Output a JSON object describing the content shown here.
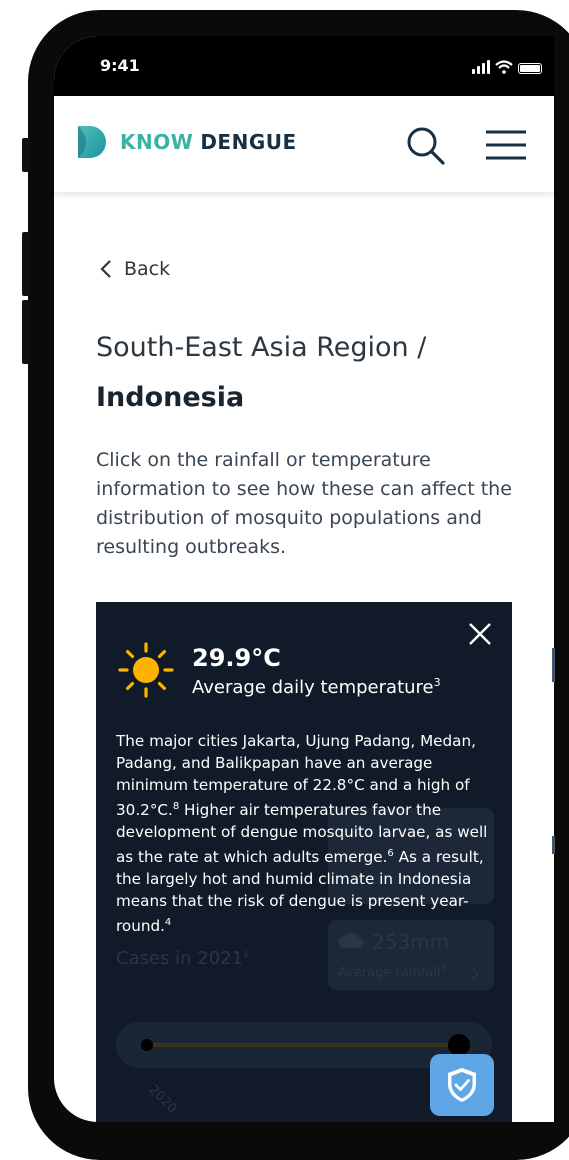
{
  "status": {
    "time": "9:41"
  },
  "header": {
    "logo_know": "KNOW",
    "logo_dengue": "DENGUE"
  },
  "nav": {
    "back_label": "Back"
  },
  "page": {
    "region": "South-East Asia Region /",
    "country": "Indonesia",
    "intro": "Click on the rainfall or temperature information to see how these can affect the distribution of mosquito populations and resulting outbreaks."
  },
  "temperature": {
    "value": "29.9°C",
    "label": "Average daily temperature",
    "label_ref": "3",
    "description": [
      {
        "text": "The major cities Jakarta, Ujung Padang, Medan, Padang, and Balikpapan have an average minimum temperature of 22.8°C and a high of 30.2°C.",
        "ref": "8"
      },
      {
        "text": " Higher air temperatures favor the development of dengue mosquito larvae, as well as the rate at which adults emerge.",
        "ref": "6"
      },
      {
        "text": " As a result, the largely hot and humid climate in Indonesia means that the risk of dengue is present year-round.",
        "ref": "4"
      }
    ]
  },
  "background_panel": {
    "cases_label": "Cases in 2021",
    "cases_ref": "1",
    "rainfall_value": "253mm",
    "rainfall_label": "Average rainfall",
    "rainfall_ref": "3",
    "timeline_year": "2020"
  },
  "icons": [
    "logo-mark",
    "search-icon",
    "menu-icon",
    "chevron-left-icon",
    "sun-icon",
    "close-icon",
    "shield-check-icon",
    "cloud-icon",
    "chevron-right-icon"
  ],
  "colors": {
    "brand_teal": "#3bb3a3",
    "brand_navy": "#163046",
    "card_bg": "#101a28",
    "sun": "#ffb300",
    "fab": "#5fa6e6"
  }
}
